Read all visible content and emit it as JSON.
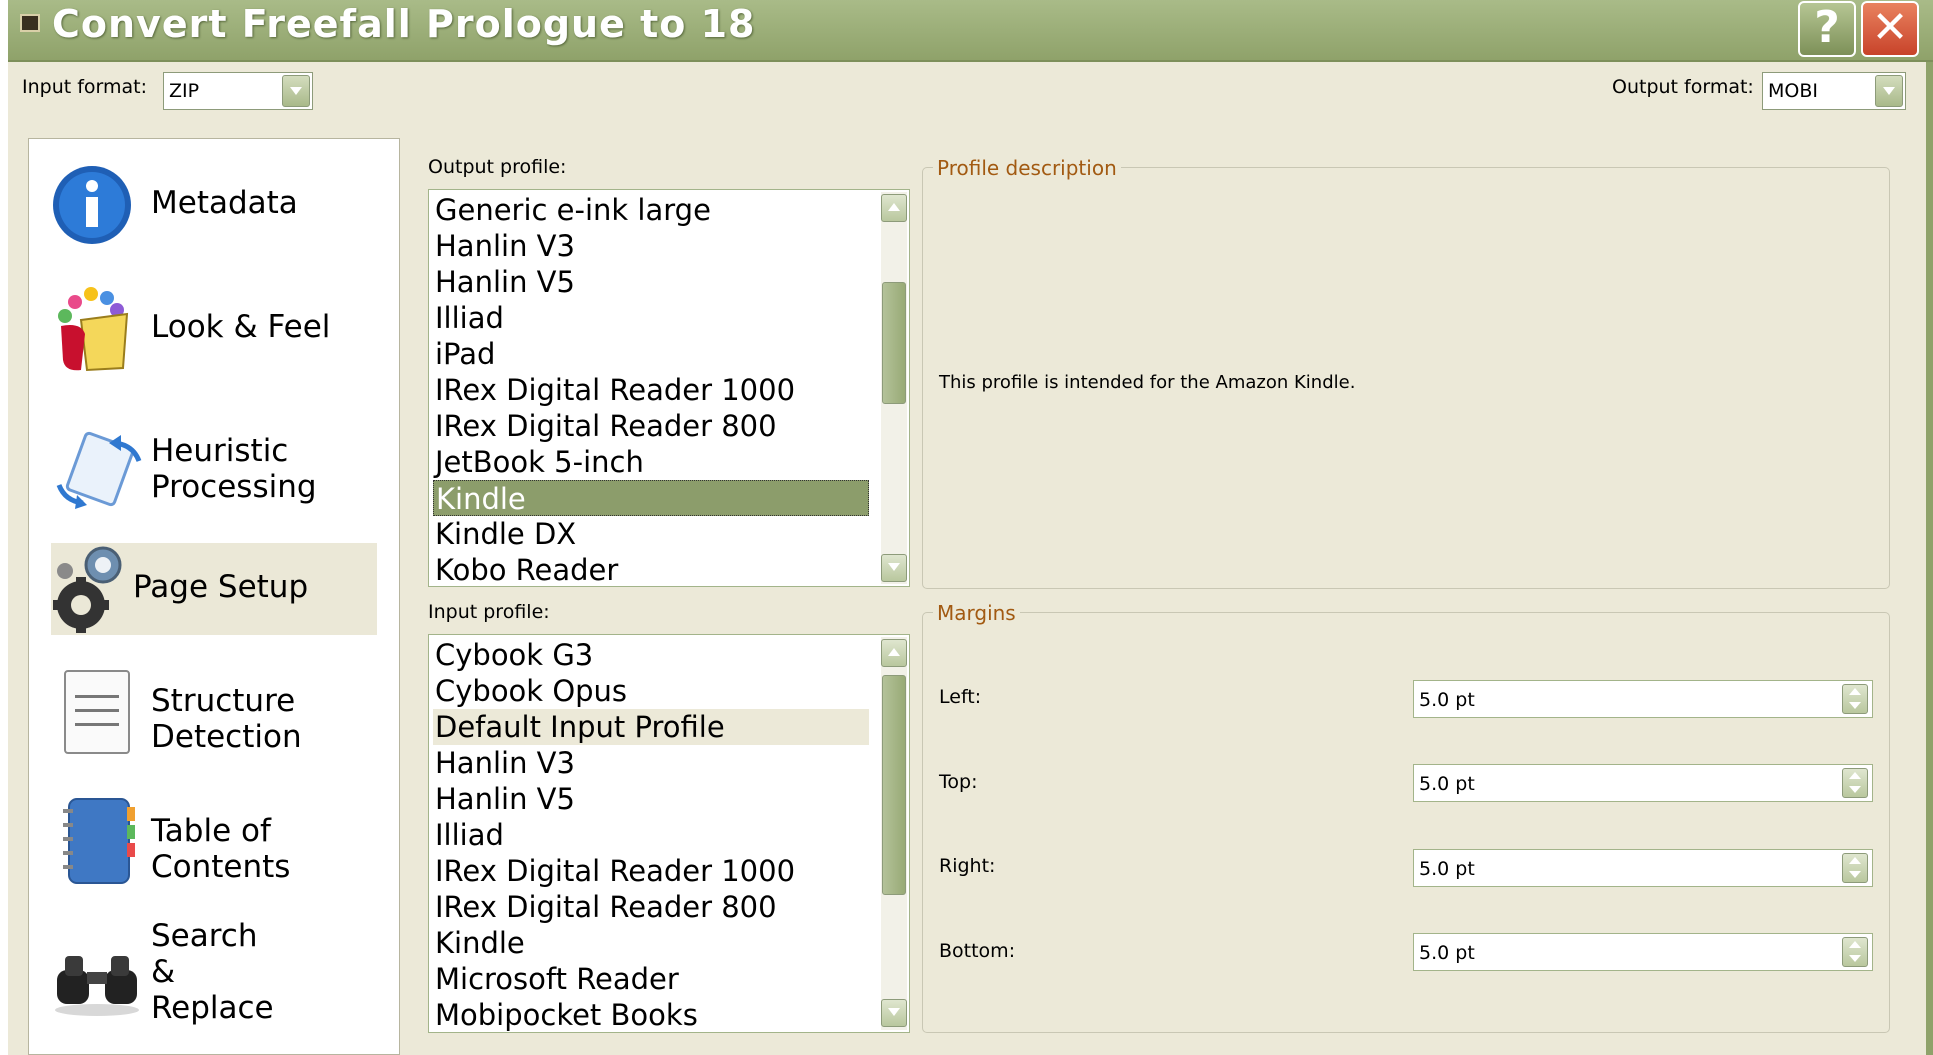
{
  "window": {
    "title": "Convert Freefall Prologue to 18",
    "help_label": "?",
    "close_label": "✕"
  },
  "formats": {
    "input_label": "Input format:",
    "input_value": "ZIP",
    "output_label": "Output format:",
    "output_value": "MOBI"
  },
  "sidebar": {
    "items": [
      {
        "label": "Metadata",
        "icon": "info-icon"
      },
      {
        "label": "Look & Feel",
        "icon": "paint-bucket-icon"
      },
      {
        "label": "Heuristic\nProcessing",
        "icon": "heuristic-arrows-icon"
      },
      {
        "label": "Page Setup",
        "icon": "gears-icon",
        "selected": true
      },
      {
        "label": "Structure\nDetection",
        "icon": "document-icon"
      },
      {
        "label": "Table of\nContents",
        "icon": "notebook-icon"
      },
      {
        "label": "Search\n&\nReplace",
        "icon": "binoculars-icon"
      }
    ]
  },
  "output_profile": {
    "label": "Output profile:",
    "items": [
      "Generic e-ink large",
      "Hanlin V3",
      "Hanlin V5",
      "Illiad",
      "iPad",
      "IRex Digital Reader 1000",
      "IRex Digital Reader 800",
      "JetBook 5-inch",
      "Kindle",
      "Kindle DX",
      "Kobo Reader"
    ],
    "selected": "Kindle"
  },
  "input_profile": {
    "label": "Input profile:",
    "items": [
      "Cybook G3",
      "Cybook Opus",
      "Default Input Profile",
      "Hanlin V3",
      "Hanlin V5",
      "Illiad",
      "IRex Digital Reader 1000",
      "IRex Digital Reader 800",
      "Kindle",
      "Microsoft Reader",
      "Mobipocket Books"
    ],
    "selected": "Default Input Profile"
  },
  "profile_description": {
    "title": "Profile description",
    "text": "This profile is intended for the Amazon Kindle."
  },
  "margins": {
    "title": "Margins",
    "fields": [
      {
        "label": "Left:",
        "value": "5.0 pt"
      },
      {
        "label": "Top:",
        "value": "5.0 pt"
      },
      {
        "label": "Right:",
        "value": "5.0 pt"
      },
      {
        "label": "Bottom:",
        "value": "5.0 pt"
      }
    ]
  },
  "colors": {
    "titlebar": "#9aad76",
    "dialog_bg": "#ece9d8",
    "selection": "#8c9d6b",
    "group_title": "#a25a12"
  }
}
